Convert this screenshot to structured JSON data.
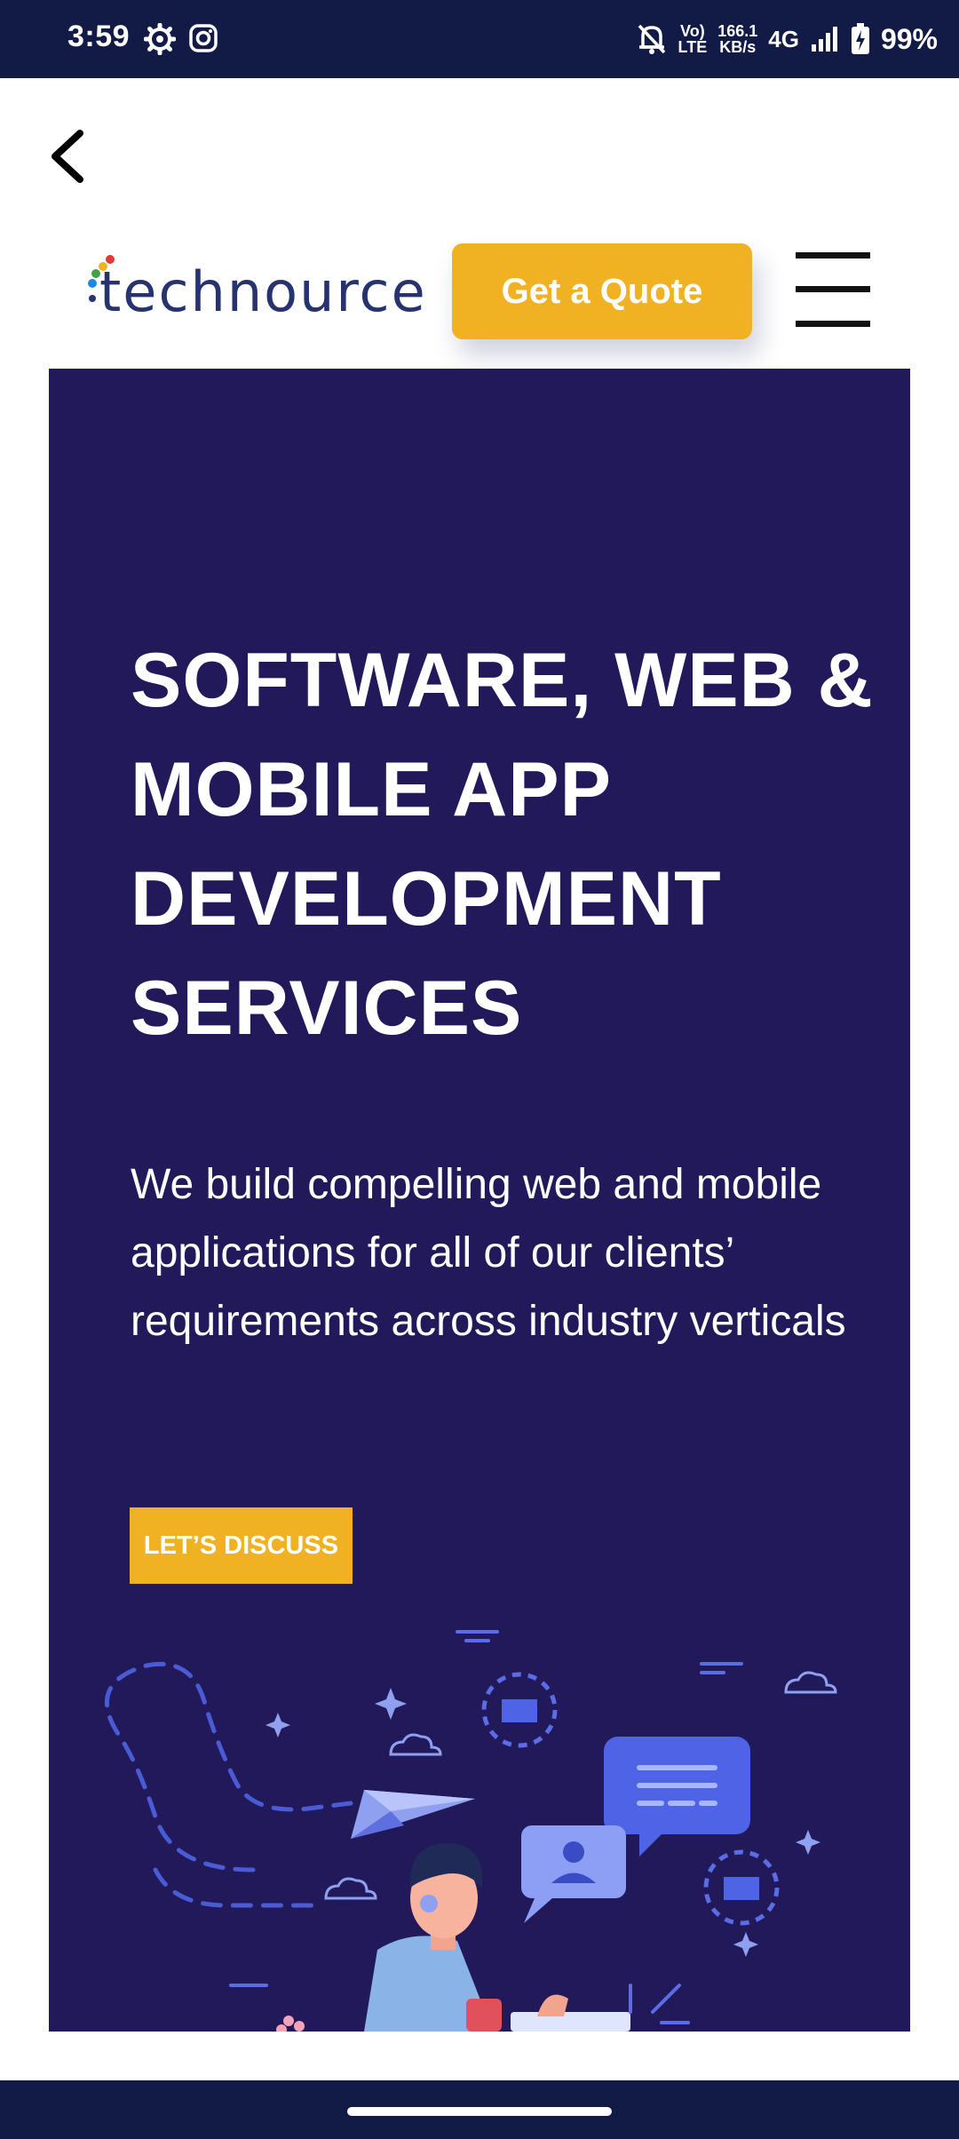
{
  "status_bar": {
    "time": "3:59",
    "volte_line1": "Vo)",
    "volte_line2": "LTE",
    "net_speed_value": "166.1",
    "net_speed_unit": "KB/s",
    "network_type": "4G",
    "battery_percent": "99%",
    "icons": [
      "settings-gear-icon",
      "instagram-icon",
      "bell-muted-icon",
      "signal-icon",
      "battery-charging-icon"
    ]
  },
  "header": {
    "logo_text": "technource",
    "quote_button_label": "Get a Quote",
    "colors": {
      "brand_yellow": "#f0b223",
      "logo_text": "#26336e"
    }
  },
  "hero": {
    "title": "SOFTWARE, WEB & MOBILE APP DEVELOPMENT SERVICES",
    "description": "We build compelling web and mobile applications for all of our clients’ requirements across industry verticals",
    "cta_label": "LET’S DISCUSS",
    "background_color": "#21195a"
  },
  "system": {
    "bar_color": "#121b45"
  }
}
